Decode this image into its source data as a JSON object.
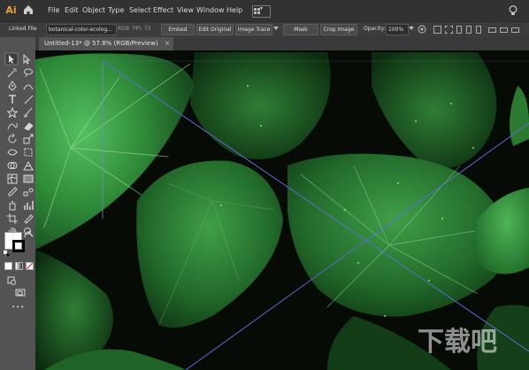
{
  "app": {
    "logo": "Ai"
  },
  "menu": {
    "items": [
      "File",
      "Edit",
      "Object",
      "Type",
      "Select",
      "Effect",
      "View",
      "Window",
      "Help"
    ]
  },
  "control_bar": {
    "linked_file": "Linked File",
    "file_name": "botanical-color-ecolog...",
    "color_mode": "RGB",
    "ppi": "PPI: 72",
    "embed": "Embed",
    "edit_original": "Edit Original",
    "image_trace": "Image Trace",
    "mask": "Mask",
    "crop_image": "Crop Image",
    "opacity_label": "Opacity:",
    "opacity_value": "100%"
  },
  "document": {
    "tab_title": "Untitled-13* @ 57.8% (RGB/Preview)",
    "close_glyph": "×"
  },
  "toolbar": {
    "more": "•••"
  },
  "watermark": {
    "text": "下载吧"
  },
  "colors": {
    "accent": "#f0a030",
    "leaf": "#2f8a3a",
    "leaf_light": "#49b356",
    "canvas_bg": "#0a0f0a",
    "selection": "#4a5fc0"
  }
}
